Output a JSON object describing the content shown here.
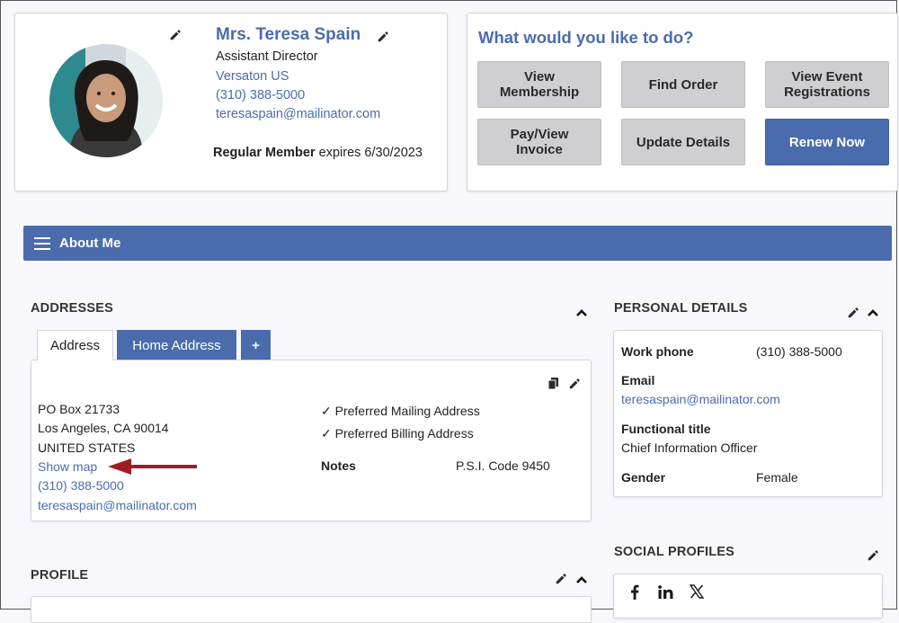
{
  "profile": {
    "name": "Mrs. Teresa Spain",
    "title": "Assistant Director",
    "company": "Versaton US",
    "phone": "(310) 388-5000",
    "email": "teresaspain@mailinator.com",
    "member_type": "Regular Member",
    "expires_text": "expires 6/30/2023"
  },
  "actions": {
    "title": "What would you like to do?",
    "buttons": [
      {
        "label_1": "View",
        "label_2": "Membership"
      },
      {
        "label_1": "Find Order",
        "label_2": ""
      },
      {
        "label_1": "View Event",
        "label_2": "Registrations"
      },
      {
        "label_1": "Pay/View",
        "label_2": "Invoice"
      },
      {
        "label_1": "Update Details",
        "label_2": ""
      },
      {
        "label_1": "Renew Now",
        "label_2": ""
      }
    ]
  },
  "about": {
    "label": "About Me"
  },
  "addresses": {
    "heading": "ADDRESSES",
    "tabs": [
      "Address",
      "Home Address",
      "+"
    ],
    "lines": [
      "PO Box 21733",
      "Los Angeles, CA 90014",
      "UNITED STATES"
    ],
    "show_map": "Show map",
    "phone": "(310) 388-5000",
    "email": "teresaspain@mailinator.com",
    "preferred": [
      "✓ Preferred Mailing Address",
      "✓ Preferred Billing Address"
    ],
    "notes_label": "Notes",
    "notes_value": "P.S.I. Code 9450"
  },
  "personal": {
    "heading": "PERSONAL DETAILS",
    "work_phone_label": "Work phone",
    "work_phone": "(310) 388-5000",
    "email_label": "Email",
    "email": "teresaspain@mailinator.com",
    "functional_title_label": "Functional title",
    "functional_title": "Chief Information Officer",
    "gender_label": "Gender",
    "gender": "Female"
  },
  "profile_section": {
    "heading": "PROFILE"
  },
  "social": {
    "heading": "SOCIAL PROFILES",
    "icons": [
      "facebook-icon",
      "linkedin-icon",
      "x-icon"
    ]
  },
  "colors": {
    "accent": "#4a6cad",
    "button_gray": "#cfcfd2",
    "annotation_arrow": "#a01c24"
  }
}
